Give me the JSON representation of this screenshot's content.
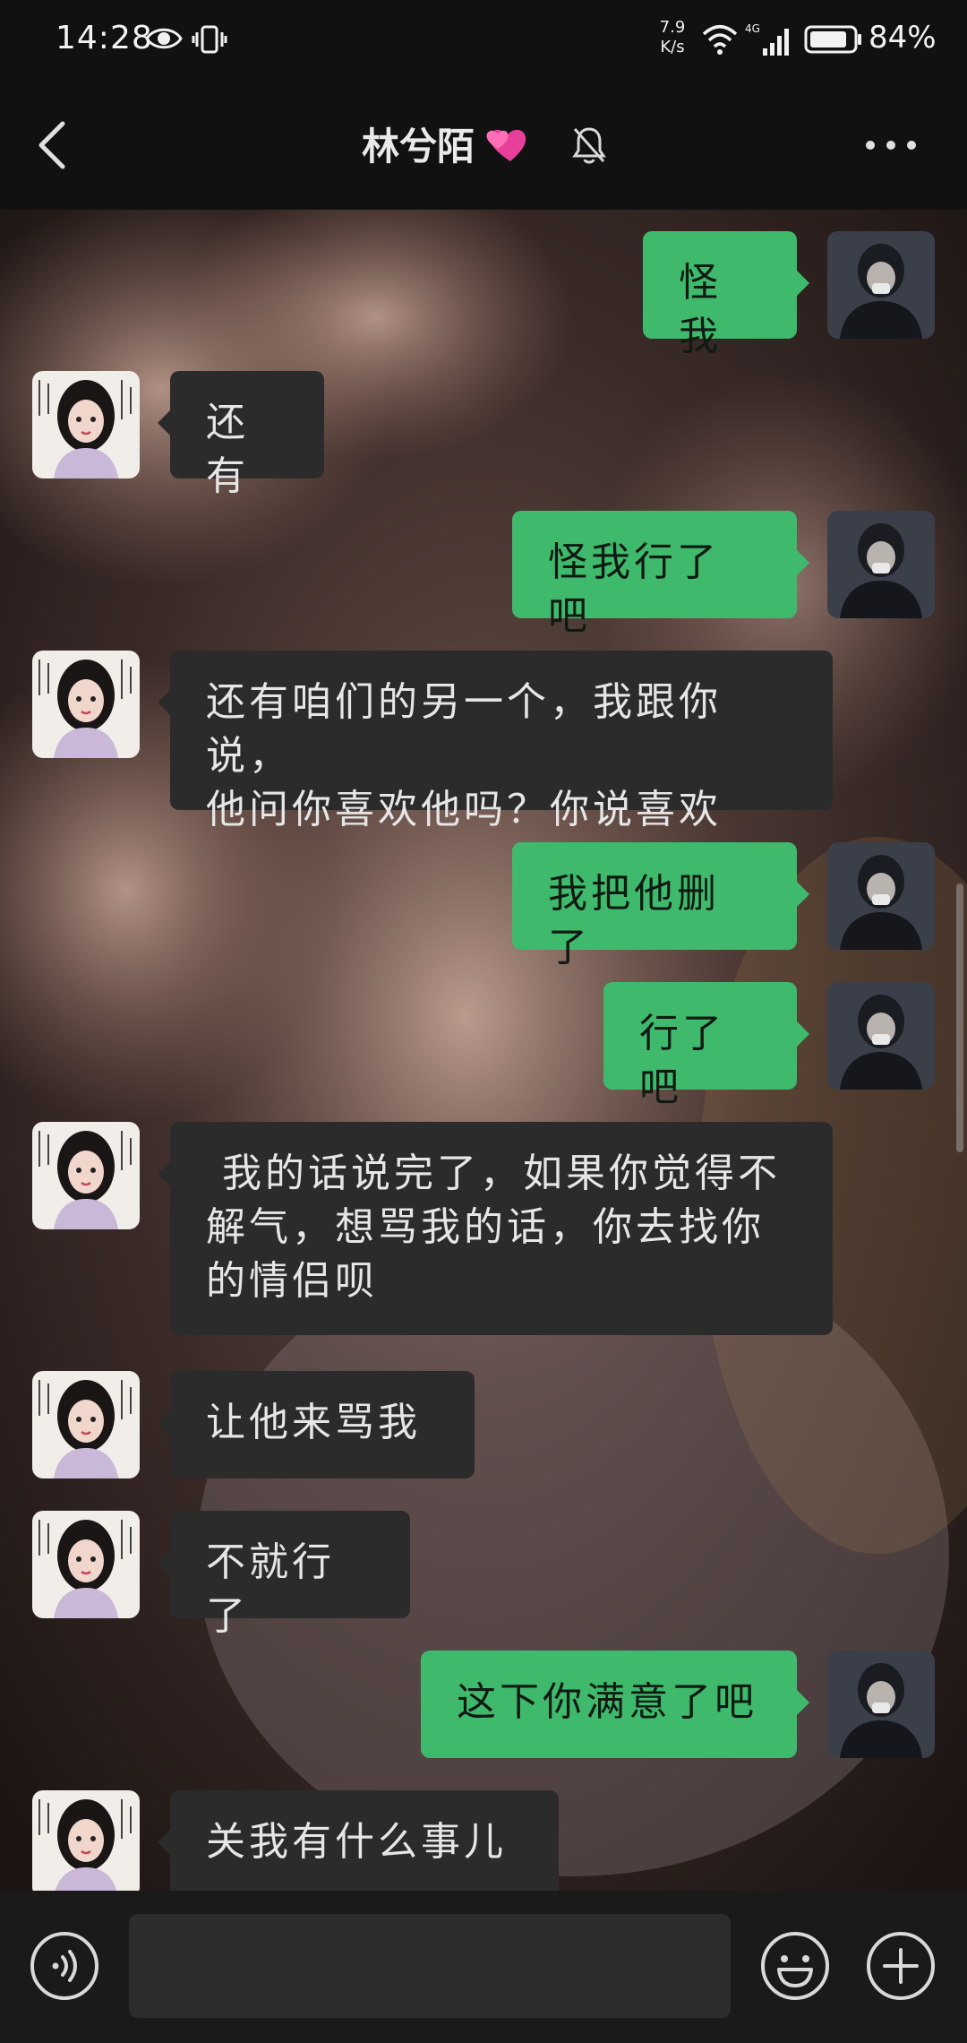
{
  "status_bar": {
    "time": "14:28",
    "net_speed_value": "7.9",
    "net_speed_unit": "K/s",
    "network_type": "4G",
    "battery_percent": "84%",
    "icons": [
      "eye-icon",
      "vibrate-icon",
      "wifi-icon",
      "signal-icon",
      "battery-icon"
    ]
  },
  "header": {
    "title": "林兮陌",
    "title_decoration": "hearts-emoji",
    "icons": [
      "back-arrow-icon",
      "mute-bell-icon",
      "more-dots-icon"
    ]
  },
  "messages": [
    {
      "sender": "me",
      "text": "怪我"
    },
    {
      "sender": "contact",
      "text": "还有"
    },
    {
      "sender": "me",
      "text": "怪我行了吧"
    },
    {
      "sender": "contact",
      "text": "还有咱们的另一个，我跟你说，\n他问你喜欢他吗？你说喜欢"
    },
    {
      "sender": "me",
      "text": "我把他删了"
    },
    {
      "sender": "me",
      "text": "行了吧"
    },
    {
      "sender": "contact",
      "text": " 我的话说完了，如果你觉得不\n解气，想骂我的话，你去找你\n的情侣呗"
    },
    {
      "sender": "contact",
      "text": "让他来骂我"
    },
    {
      "sender": "contact",
      "text": "不就行了"
    },
    {
      "sender": "me",
      "text": "这下你满意了吧"
    },
    {
      "sender": "contact",
      "text": "关我有什么事儿"
    }
  ],
  "input_bar": {
    "message_value": "",
    "icons": [
      "voice-icon",
      "emoji-icon",
      "plus-icon"
    ]
  },
  "colors": {
    "sent_bubble": "#3fba6d",
    "received_bubble": "#2b2b2b",
    "bar_background": "#111111"
  }
}
